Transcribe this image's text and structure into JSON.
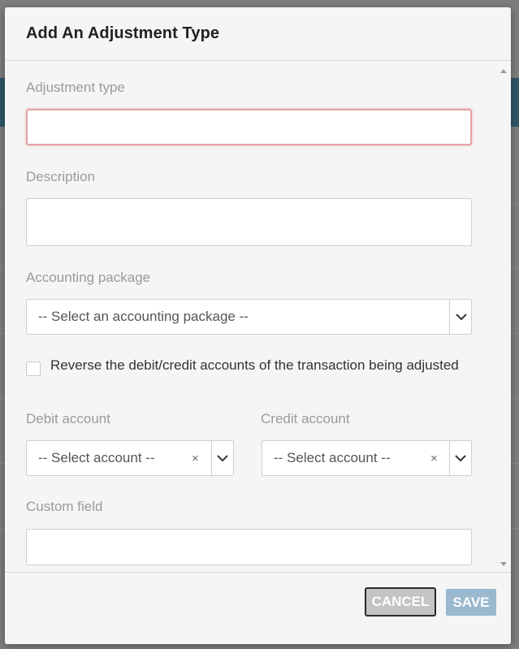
{
  "modal": {
    "title": "Add An Adjustment Type"
  },
  "form": {
    "adjustment_type": {
      "label": "Adjustment type",
      "value": ""
    },
    "description": {
      "label": "Description",
      "value": ""
    },
    "accounting_package": {
      "label": "Accounting package",
      "selected": "-- Select an accounting package --"
    },
    "reverse_checkbox": {
      "label": "Reverse the debit/credit accounts of the transaction being adjusted",
      "checked": false
    },
    "debit_account": {
      "label": "Debit account",
      "selected": "-- Select account --"
    },
    "credit_account": {
      "label": "Credit account",
      "selected": "-- Select account --"
    },
    "custom_field": {
      "label": "Custom field",
      "value": ""
    }
  },
  "footer": {
    "cancel_label": "CANCEL",
    "save_label": "SAVE"
  },
  "icons": {
    "clear": "×",
    "chevron": "chevron-down"
  },
  "colors": {
    "error_border": "#e3a1a5",
    "save_button": "#9ab9cf",
    "cancel_button": "#c4c4c4"
  }
}
